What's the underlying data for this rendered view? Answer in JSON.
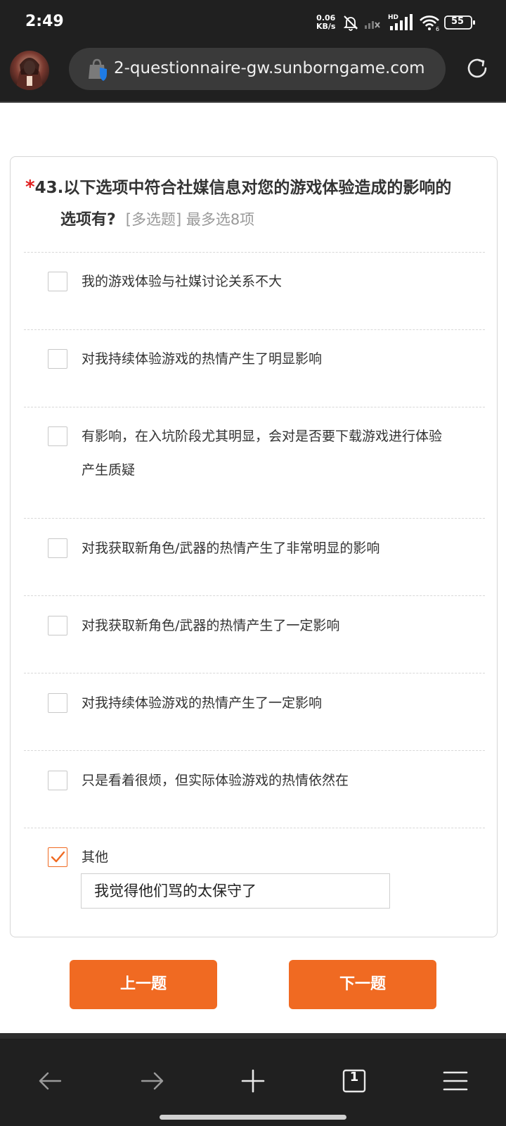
{
  "status_bar": {
    "time": "2:49",
    "net_speed_value": "0.06",
    "net_speed_unit": "KB/s",
    "hd_label": "HD",
    "wifi_sub": "6",
    "battery": "55"
  },
  "browser": {
    "url": "2-questionnaire-gw.sunborngame.com"
  },
  "question": {
    "required_mark": "*",
    "title_line1": "43.以下选项中符合社媒信息对您的游戏体验造成的影响的",
    "title_line2": "选项有?",
    "hint": "[多选题] 最多选8项"
  },
  "options": [
    {
      "label": "我的游戏体验与社媒讨论关系不大",
      "checked": false
    },
    {
      "label": "对我持续体验游戏的热情产生了明显影响",
      "checked": false
    },
    {
      "label_line1": "有影响，在入坑阶段尤其明显，会对是否要下载游戏进行体验",
      "label_line2": "产生质疑",
      "checked": false
    },
    {
      "label": "对我获取新角色/武器的热情产生了非常明显的影响",
      "checked": false
    },
    {
      "label": "对我获取新角色/武器的热情产生了一定影响",
      "checked": false
    },
    {
      "label": "对我持续体验游戏的热情产生了一定影响",
      "checked": false
    },
    {
      "label": "只是看着很烦，但实际体验游戏的热情依然在",
      "checked": false
    },
    {
      "label": "其他",
      "checked": true,
      "input_value": "我觉得他们骂的太保守了"
    }
  ],
  "buttons": {
    "prev": "上一题",
    "next": "下一题"
  },
  "bottom_nav": {
    "tab_count": "1"
  },
  "colors": {
    "accent": "#f06a22",
    "required": "#e02020",
    "bar_bg": "#202020"
  }
}
